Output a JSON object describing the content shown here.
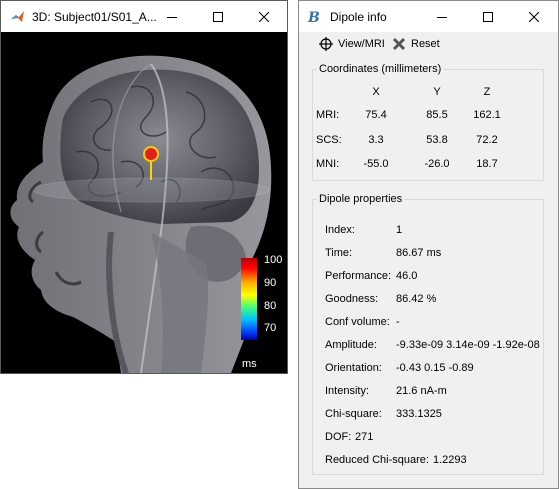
{
  "window_3d": {
    "title": "3D: Subject01/S01_A...",
    "colorbar": {
      "labels": [
        "100",
        "90",
        "80",
        "70"
      ],
      "unit": "ms"
    }
  },
  "window_info": {
    "title": "Dipole info",
    "toolbar": {
      "view_mri_label": "View/MRI",
      "reset_label": "Reset"
    },
    "coordinates": {
      "title": "Coordinates (millimeters)",
      "columns": [
        "X",
        "Y",
        "Z"
      ],
      "rows": [
        {
          "label": "MRI:",
          "values": [
            "75.4",
            "85.5",
            "162.1"
          ]
        },
        {
          "label": "SCS:",
          "values": [
            "3.3",
            "53.8",
            "72.2"
          ]
        },
        {
          "label": "MNI:",
          "values": [
            "-55.0",
            "-26.0",
            "18.7"
          ]
        }
      ]
    },
    "properties": {
      "title": "Dipole properties",
      "rows": [
        {
          "label": "Index:",
          "value": "1"
        },
        {
          "label": "Time:",
          "value": "86.67 ms"
        },
        {
          "label": "Performance:",
          "value": "46.0"
        },
        {
          "label": "Goodness:",
          "value": "86.42 %"
        },
        {
          "label": "Conf volume:",
          "value": "-"
        },
        {
          "label": "Amplitude:",
          "value": "-9.33e-09 3.14e-09 -1.92e-08"
        },
        {
          "label": "Orientation:",
          "value": "-0.43 0.15 -0.89"
        },
        {
          "label": "Intensity:",
          "value": "21.6 nA-m"
        },
        {
          "label": "Chi-square:",
          "value": "333.1325"
        },
        {
          "label": "DOF:",
          "value": "271"
        },
        {
          "label": "Reduced Chi-square:",
          "value": "1.2293"
        }
      ]
    }
  }
}
